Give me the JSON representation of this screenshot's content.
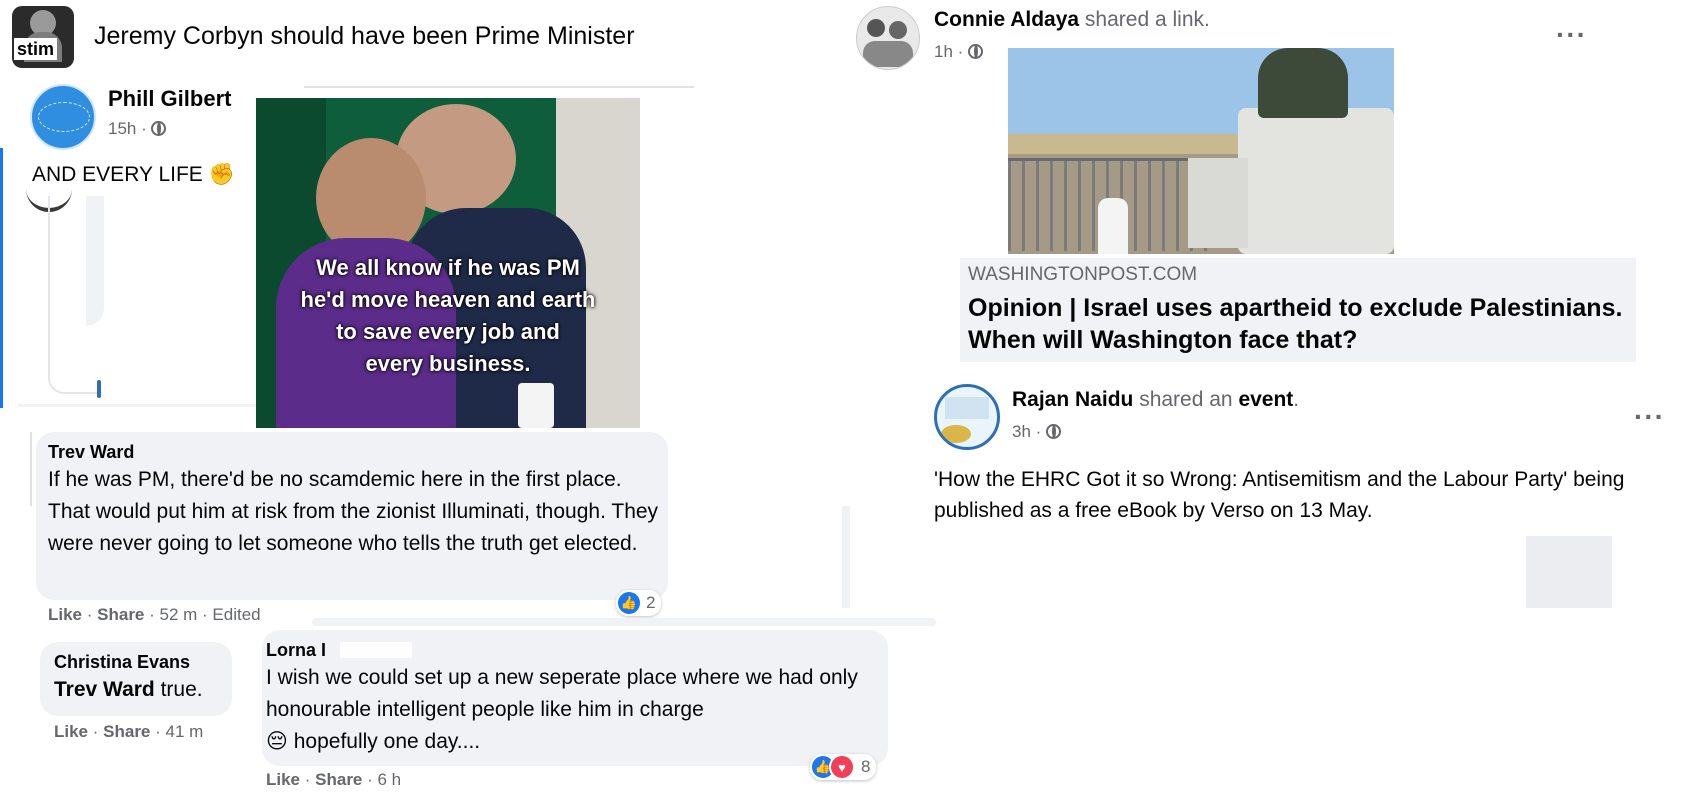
{
  "group": {
    "title": "Jeremy Corbyn should have been Prime Minister",
    "avatar_text": "stim"
  },
  "post1": {
    "author": "Phill Gilbert",
    "time": "15h ·",
    "text": "AND EVERY LIFE",
    "emoji": "✊",
    "image_caption_lines": [
      "We all know if he was PM",
      "he'd move heaven and earth",
      "to save every job and",
      "every business."
    ]
  },
  "comment1": {
    "author": "Trev Ward",
    "text": "If he was PM, there'd be no scamdemic here in the first place. That would put him at risk from the zionist Illuminati, though. They were never going to let someone who tells the truth get elected.",
    "like": "Like",
    "share": "Share",
    "meta": "· 52 m · Edited",
    "reaction_count": "2"
  },
  "comment2": {
    "author": "Christina Evans",
    "mention": "Trev Ward",
    "text": " true.",
    "like": "Like",
    "share": "Share",
    "meta": "· 41 m"
  },
  "comment3": {
    "author": "Lorna I",
    "text": "I wish we could set up a new seperate place where we had only honourable intelligent people like him in charge",
    "text_end": " hopefully one day....",
    "emoji": "😔",
    "like": "Like",
    "share": "Share",
    "meta": "· 6 h",
    "reaction_count": "8"
  },
  "post2": {
    "author": "Connie Aldaya",
    "action": " shared a link.",
    "time": "1h ·",
    "domain": "WASHINGTONPOST.COM",
    "headline": "Opinion | Israel uses apartheid to exclude Palestinians. When will Washington face that?"
  },
  "post3": {
    "author": "Rajan Naidu",
    "action1": " shared an ",
    "action_link": "event",
    "action2": ".",
    "time": "3h ·",
    "text": "'How the EHRC Got it so Wrong: Antisemitism and the Labour Party' being published as a free eBook by Verso on 13 May."
  },
  "colors": {
    "bubble": "#f0f2f5",
    "muted": "#65676b",
    "like_blue": "#1877f2",
    "love_red": "#f33e58"
  },
  "icons": [
    "globe-icon",
    "more-options-icon",
    "like-reaction-icon",
    "love-reaction-icon"
  ]
}
